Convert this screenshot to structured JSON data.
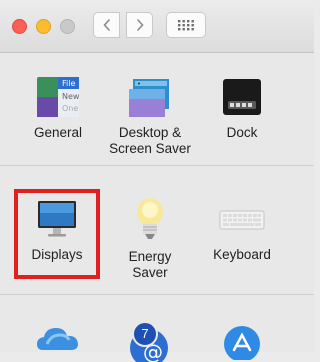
{
  "toolbar": {
    "back_icon": "chevron-left-icon",
    "forward_icon": "chevron-right-icon",
    "grid_icon": "grid-icon"
  },
  "row1": [
    {
      "label": "General",
      "icon": "general-icon",
      "icon_text": [
        "File",
        "New",
        "One"
      ]
    },
    {
      "label": "Desktop &\nScreen Saver",
      "icon": "desktop-screensaver-icon"
    },
    {
      "label": "Dock",
      "icon": "dock-icon"
    }
  ],
  "row2": [
    {
      "label": "Displays",
      "icon": "displays-icon",
      "highlighted": true
    },
    {
      "label": "Energy\nSaver",
      "icon": "energy-saver-icon"
    },
    {
      "label": "Keyboard",
      "icon": "keyboard-icon"
    }
  ],
  "row3": [
    {
      "icon": "icloud-icon"
    },
    {
      "icon": "internet-accounts-icon",
      "badge": "7"
    },
    {
      "icon": "app-store-icon"
    }
  ],
  "colors": {
    "highlight": "#e02020",
    "close": "#fc5f57",
    "minimize": "#fdbc2e"
  }
}
